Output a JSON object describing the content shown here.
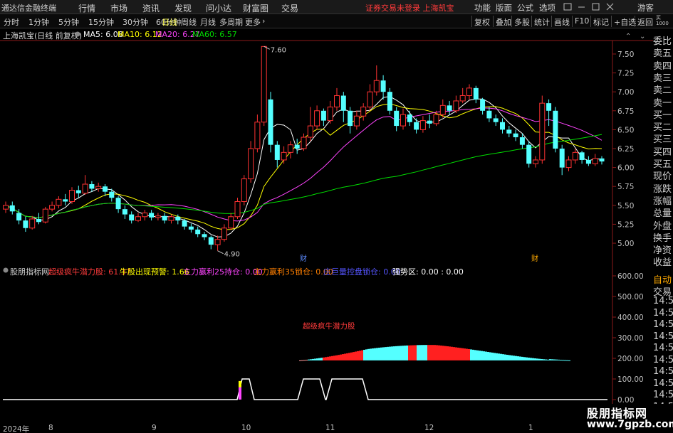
{
  "app": {
    "title": "通达信金融终端",
    "menus": [
      "行情",
      "市场",
      "资讯",
      "发现",
      "问小达",
      "财富圈",
      "交易"
    ],
    "broker_status": "证券交易未登录 上海凯宝",
    "right_menus": [
      "功能",
      "版面",
      "公式",
      "选项"
    ],
    "guest": "游客"
  },
  "periods": [
    "分时",
    "1分钟",
    "5分钟",
    "15分钟",
    "30分钟",
    "60分钟",
    "日线",
    "周线",
    "月线",
    "多周期",
    "更多"
  ],
  "active_period": "日线",
  "toolbar_buttons": [
    "复权",
    "叠加",
    "多股",
    "统计",
    "画线",
    "F10",
    "标记",
    "+自选",
    "返回"
  ],
  "stock": {
    "label": "上海凯宝(日线 前复权)",
    "ma": [
      {
        "text": "MA5: 6.08",
        "color": "#ffffff"
      },
      {
        "text": "MA10: 6.12",
        "color": "#ffff00"
      },
      {
        "text": "MA20: 6.27",
        "color": "#ff44ff"
      },
      {
        "text": "MA60: 6.57",
        "color": "#00dd00"
      }
    ]
  },
  "price_axis": [
    "7.50",
    "7.25",
    "7.00",
    "6.75",
    "6.50",
    "6.25",
    "6.00",
    "5.75",
    "5.50",
    "5.25",
    "5.00"
  ],
  "annotations": {
    "high": "7.60",
    "low": "4.90",
    "fin1": "财",
    "fin2": "财"
  },
  "side_tabs": [
    "委比",
    "卖五",
    "卖四",
    "卖三",
    "卖二",
    "卖一",
    "买一",
    "买二",
    "买三",
    "买四",
    "买五",
    "现价",
    "涨跌",
    "涨幅",
    "总量",
    "外盘",
    "换手",
    "净资",
    "收益"
  ],
  "side_ind": [
    "自动",
    "交易",
    "14:5",
    "14:5",
    "14:5",
    "14:5",
    "14:5",
    "14:5",
    "14:5",
    "14:5",
    "14:5",
    "14:5"
  ],
  "indicator": {
    "name": "股朋指标网",
    "items": [
      {
        "text": "超级疯牛潜力股: 61.37",
        "color": "#ff3b3b"
      },
      {
        "text": "牛股出现预警: 1.66",
        "color": "#ffff00"
      },
      {
        "text": "主力嬴利25持仓: 0.00",
        "color": "#ff44ff"
      },
      {
        "text": "主力嬴利35锁仓: 0.00",
        "color": "#ff7f00"
      },
      {
        "text": "庄巨量控盘锁仓: 0.00",
        "color": "#5555ff"
      },
      {
        "text": "强势区: 0.00 : 0.00",
        "color": "#ffffff"
      }
    ],
    "center_label": "超级疯牛潜力股",
    "axis": [
      "600.00",
      "500.00",
      "400.00",
      "300.00",
      "200.00",
      "100.00",
      "0.00"
    ]
  },
  "dates": [
    "2024年",
    "8",
    "9",
    "10",
    "11",
    "12",
    "1"
  ],
  "watermark": {
    "title": "股朋指标网",
    "url": "www.7gpzb.com"
  },
  "chart_data": {
    "type": "candlestick",
    "title": "上海凯宝(日线 前复权)",
    "ylim": [
      4.85,
      7.65
    ],
    "x_labels": [
      "2024年",
      "8",
      "9",
      "10",
      "11",
      "12",
      "1"
    ],
    "candles": [
      [
        5.45,
        5.5,
        5.55,
        5.4
      ],
      [
        5.5,
        5.42,
        5.55,
        5.38
      ],
      [
        5.4,
        5.3,
        5.45,
        5.25
      ],
      [
        5.3,
        5.2,
        5.35,
        5.15
      ],
      [
        5.2,
        5.32,
        5.36,
        5.18
      ],
      [
        5.32,
        5.28,
        5.4,
        5.25
      ],
      [
        5.28,
        5.45,
        5.48,
        5.26
      ],
      [
        5.45,
        5.5,
        5.55,
        5.42
      ],
      [
        5.5,
        5.58,
        5.62,
        5.46
      ],
      [
        5.58,
        5.55,
        5.65,
        5.5
      ],
      [
        5.55,
        5.7,
        5.74,
        5.52
      ],
      [
        5.7,
        5.66,
        5.76,
        5.6
      ],
      [
        5.66,
        5.78,
        5.9,
        5.64
      ],
      [
        5.78,
        5.72,
        5.82,
        5.68
      ],
      [
        5.72,
        5.75,
        5.8,
        5.68
      ],
      [
        5.75,
        5.68,
        5.78,
        5.62
      ],
      [
        5.68,
        5.6,
        5.72,
        5.55
      ],
      [
        5.6,
        5.45,
        5.62,
        5.4
      ],
      [
        5.45,
        5.38,
        5.5,
        5.32
      ],
      [
        5.38,
        5.3,
        5.42,
        5.26
      ],
      [
        5.3,
        5.35,
        5.4,
        5.28
      ],
      [
        5.35,
        5.4,
        5.44,
        5.3
      ],
      [
        5.4,
        5.34,
        5.44,
        5.3
      ],
      [
        5.34,
        5.36,
        5.4,
        5.3
      ],
      [
        5.36,
        5.3,
        5.4,
        5.26
      ],
      [
        5.3,
        5.35,
        5.38,
        5.26
      ],
      [
        5.35,
        5.3,
        5.38,
        5.25
      ],
      [
        5.3,
        5.22,
        5.32,
        5.18
      ],
      [
        5.22,
        5.18,
        5.26,
        5.14
      ],
      [
        5.18,
        5.12,
        5.22,
        5.08
      ],
      [
        5.12,
        5.08,
        5.15,
        5.04
      ],
      [
        5.08,
        4.98,
        5.1,
        4.92
      ],
      [
        4.98,
        5.05,
        5.1,
        4.9
      ],
      [
        5.05,
        5.2,
        5.25,
        5.02
      ],
      [
        5.2,
        5.35,
        5.4,
        5.18
      ],
      [
        5.35,
        5.55,
        5.6,
        5.32
      ],
      [
        5.55,
        5.85,
        5.9,
        5.5
      ],
      [
        5.85,
        6.25,
        6.35,
        5.8
      ],
      [
        6.25,
        6.6,
        6.7,
        6.2
      ],
      [
        6.6,
        7.6,
        7.6,
        6.55
      ],
      [
        6.9,
        6.3,
        7.0,
        6.2
      ],
      [
        6.3,
        6.1,
        6.35,
        6.0
      ],
      [
        6.1,
        6.2,
        6.28,
        6.05
      ],
      [
        6.2,
        6.3,
        6.35,
        6.12
      ],
      [
        6.3,
        6.25,
        6.38,
        6.18
      ],
      [
        6.25,
        6.4,
        6.45,
        6.22
      ],
      [
        6.4,
        6.55,
        6.8,
        6.35
      ],
      [
        6.55,
        6.75,
        6.82,
        6.5
      ],
      [
        6.75,
        6.62,
        6.78,
        6.55
      ],
      [
        6.62,
        6.8,
        6.88,
        6.58
      ],
      [
        6.8,
        6.95,
        7.05,
        6.75
      ],
      [
        6.95,
        6.75,
        7.0,
        6.6
      ],
      [
        6.75,
        6.55,
        6.8,
        6.45
      ],
      [
        6.55,
        6.68,
        6.75,
        6.5
      ],
      [
        6.68,
        6.8,
        6.85,
        6.62
      ],
      [
        6.8,
        7.0,
        7.1,
        6.75
      ],
      [
        7.0,
        7.15,
        7.35,
        6.95
      ],
      [
        7.15,
        7.0,
        7.22,
        6.9
      ],
      [
        7.0,
        6.75,
        7.05,
        6.7
      ],
      [
        6.75,
        6.55,
        6.8,
        6.48
      ],
      [
        6.55,
        6.7,
        6.78,
        6.5
      ],
      [
        6.7,
        6.6,
        6.75,
        6.55
      ],
      [
        6.6,
        6.5,
        6.65,
        6.45
      ],
      [
        6.5,
        6.62,
        6.68,
        6.46
      ],
      [
        6.62,
        6.58,
        6.7,
        6.52
      ],
      [
        6.58,
        6.7,
        6.75,
        6.55
      ],
      [
        6.7,
        6.82,
        6.9,
        6.66
      ],
      [
        6.82,
        6.75,
        6.88,
        6.7
      ],
      [
        6.75,
        6.88,
        6.95,
        6.72
      ],
      [
        6.88,
        6.95,
        7.05,
        6.85
      ],
      [
        6.95,
        7.05,
        7.1,
        6.9
      ],
      [
        7.05,
        6.9,
        7.08,
        6.85
      ],
      [
        6.9,
        6.75,
        6.92,
        6.7
      ],
      [
        6.75,
        6.65,
        6.8,
        6.6
      ],
      [
        6.65,
        6.6,
        6.7,
        6.55
      ],
      [
        6.6,
        6.5,
        6.65,
        6.45
      ],
      [
        6.5,
        6.45,
        6.55,
        6.4
      ],
      [
        6.45,
        6.4,
        6.5,
        6.35
      ],
      [
        6.4,
        6.3,
        6.45,
        6.25
      ],
      [
        6.3,
        6.05,
        6.35,
        6.0
      ],
      [
        6.05,
        6.1,
        6.15,
        6.0
      ],
      [
        6.1,
        6.85,
        6.95,
        6.05
      ],
      [
        6.85,
        6.75,
        6.9,
        6.55
      ],
      [
        6.75,
        6.25,
        6.8,
        6.2
      ],
      [
        6.25,
        6.0,
        6.3,
        5.9
      ],
      [
        6.0,
        6.1,
        6.15,
        5.95
      ],
      [
        6.1,
        6.2,
        6.25,
        6.05
      ],
      [
        6.2,
        6.1,
        6.22,
        6.05
      ],
      [
        6.1,
        6.05,
        6.15,
        6.02
      ],
      [
        6.05,
        6.12,
        6.18,
        6.02
      ],
      [
        6.12,
        6.08,
        6.15,
        6.04
      ]
    ]
  }
}
